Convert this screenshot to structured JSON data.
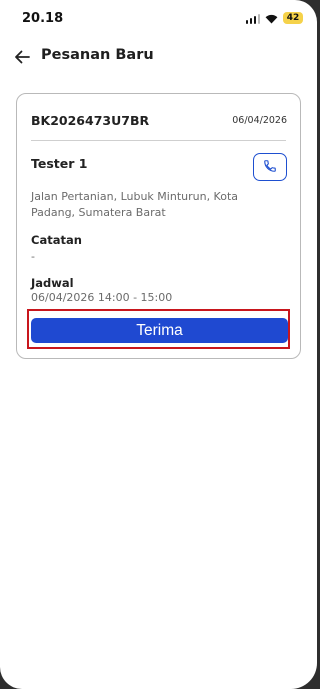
{
  "status_bar": {
    "time": "20.18",
    "battery": "42"
  },
  "header": {
    "title": "Pesanan Baru"
  },
  "order": {
    "booking_code": "BK2026473U7BR",
    "date": "06/04/2026",
    "customer_name": "Tester 1",
    "address": "Jalan Pertanian, Lubuk Minturun, Kota Padang, Sumatera Barat",
    "notes_label": "Catatan",
    "notes_value": "-",
    "schedule_label": "Jadwal",
    "schedule_value": "06/04/2026 14:00 - 15:00",
    "accept_label": "Terima"
  },
  "colors": {
    "primary": "#1f49d1",
    "highlight": "#c8161d",
    "battery": "#f5d24a"
  }
}
